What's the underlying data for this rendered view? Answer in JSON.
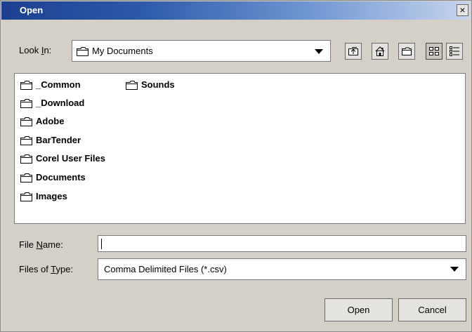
{
  "window": {
    "title": "Open",
    "close_glyph": "×"
  },
  "lookin": {
    "label_prefix": "Look ",
    "label_mnemonic": "I",
    "label_suffix": "n:",
    "value": "My Documents",
    "icon": "folder-icon"
  },
  "toolbar": [
    {
      "name": "up-one-level",
      "icon": "up-folder-icon"
    },
    {
      "name": "home",
      "icon": "home-icon"
    },
    {
      "name": "new-folder",
      "icon": "new-folder-icon"
    },
    {
      "name": "list-view",
      "icon": "list-view-icon",
      "active": true
    },
    {
      "name": "details-view",
      "icon": "details-view-icon"
    }
  ],
  "files": [
    "_Common",
    "_Download",
    "Adobe",
    "BarTender",
    "Corel User Files",
    "Documents",
    "Images",
    "Sounds"
  ],
  "filename": {
    "label_prefix": "File ",
    "label_mnemonic": "N",
    "label_suffix": "ame:",
    "value": "",
    "placeholder": ""
  },
  "filetype": {
    "label_prefix": "Files of ",
    "label_mnemonic": "T",
    "label_suffix": "ype:",
    "value": "Comma Delimited Files (*.csv)"
  },
  "buttons": {
    "open": "Open",
    "cancel": "Cancel"
  },
  "colors": {
    "title_start": "#1c3f8f",
    "title_end": "#c6d6ee",
    "panel": "#d4d0c8"
  }
}
